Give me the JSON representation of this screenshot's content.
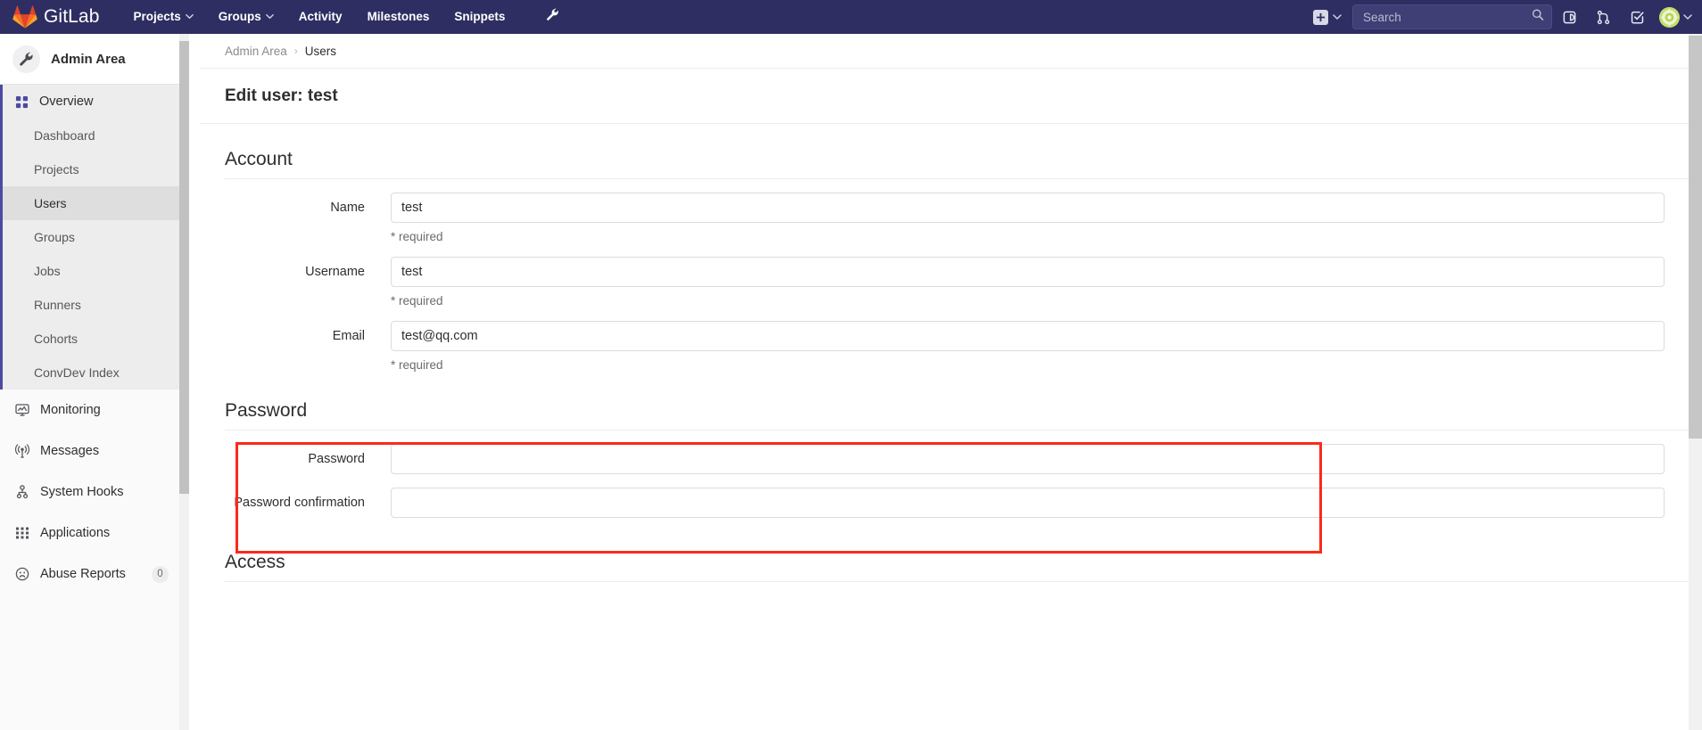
{
  "navbar": {
    "brand": "GitLab",
    "links": [
      {
        "label": "Projects",
        "has_caret": true,
        "icon": "chevron-down-icon"
      },
      {
        "label": "Groups",
        "has_caret": true,
        "icon": "chevron-down-icon"
      },
      {
        "label": "Activity",
        "has_caret": false
      },
      {
        "label": "Milestones",
        "has_caret": false
      },
      {
        "label": "Snippets",
        "has_caret": false
      }
    ],
    "admin_wrench_icon": "wrench-icon",
    "new_icon": "plus-square-icon",
    "new_caret_icon": "chevron-down-icon",
    "search": {
      "placeholder": "Search",
      "value": "",
      "icon": "search-icon"
    },
    "right_icons": [
      {
        "name": "issues-icon"
      },
      {
        "name": "merge-requests-icon"
      },
      {
        "name": "todos-icon"
      }
    ],
    "avatar": {
      "name": "user-avatar",
      "caret_icon": "chevron-down-icon"
    }
  },
  "sidebar": {
    "header": {
      "title": "Admin Area",
      "icon": "wrench-icon"
    },
    "group": {
      "label": "Overview",
      "icon": "grid-overview-icon",
      "items": [
        {
          "label": "Dashboard",
          "active": false
        },
        {
          "label": "Projects",
          "active": false
        },
        {
          "label": "Users",
          "active": true
        },
        {
          "label": "Groups",
          "active": false
        },
        {
          "label": "Jobs",
          "active": false
        },
        {
          "label": "Runners",
          "active": false
        },
        {
          "label": "Cohorts",
          "active": false
        },
        {
          "label": "ConvDev Index",
          "active": false
        }
      ]
    },
    "items": [
      {
        "label": "Monitoring",
        "icon": "monitor-icon",
        "badge": ""
      },
      {
        "label": "Messages",
        "icon": "broadcast-icon",
        "badge": ""
      },
      {
        "label": "System Hooks",
        "icon": "hook-icon",
        "badge": ""
      },
      {
        "label": "Applications",
        "icon": "applications-grid-icon",
        "badge": ""
      },
      {
        "label": "Abuse Reports",
        "icon": "sad-face-icon",
        "badge": "0"
      }
    ]
  },
  "breadcrumb": {
    "items": [
      {
        "label": "Admin Area",
        "current": false
      },
      {
        "label": "Users",
        "current": true
      }
    ],
    "separator": "›"
  },
  "page": {
    "title": "Edit user: test"
  },
  "sections": {
    "account": {
      "heading": "Account",
      "fields": [
        {
          "label": "Name",
          "value": "test",
          "hint": "* required",
          "type": "text"
        },
        {
          "label": "Username",
          "value": "test",
          "hint": "* required",
          "type": "text"
        },
        {
          "label": "Email",
          "value": "test@qq.com",
          "hint": "* required",
          "type": "text"
        }
      ]
    },
    "password": {
      "heading": "Password",
      "fields": [
        {
          "label": "Password",
          "value": "",
          "hint": "",
          "type": "password"
        },
        {
          "label": "Password confirmation",
          "value": "",
          "hint": "",
          "type": "password"
        }
      ]
    },
    "access": {
      "heading": "Access"
    }
  },
  "annotation": {
    "highlight_color": "#fb2a19",
    "target": "password-section"
  },
  "colors": {
    "navbar": "#2e2e63",
    "sidebar_bg": "#fafafa",
    "active_item": "#dedede",
    "accent": "#4b4ba3",
    "highlight": "#fb2a19"
  }
}
